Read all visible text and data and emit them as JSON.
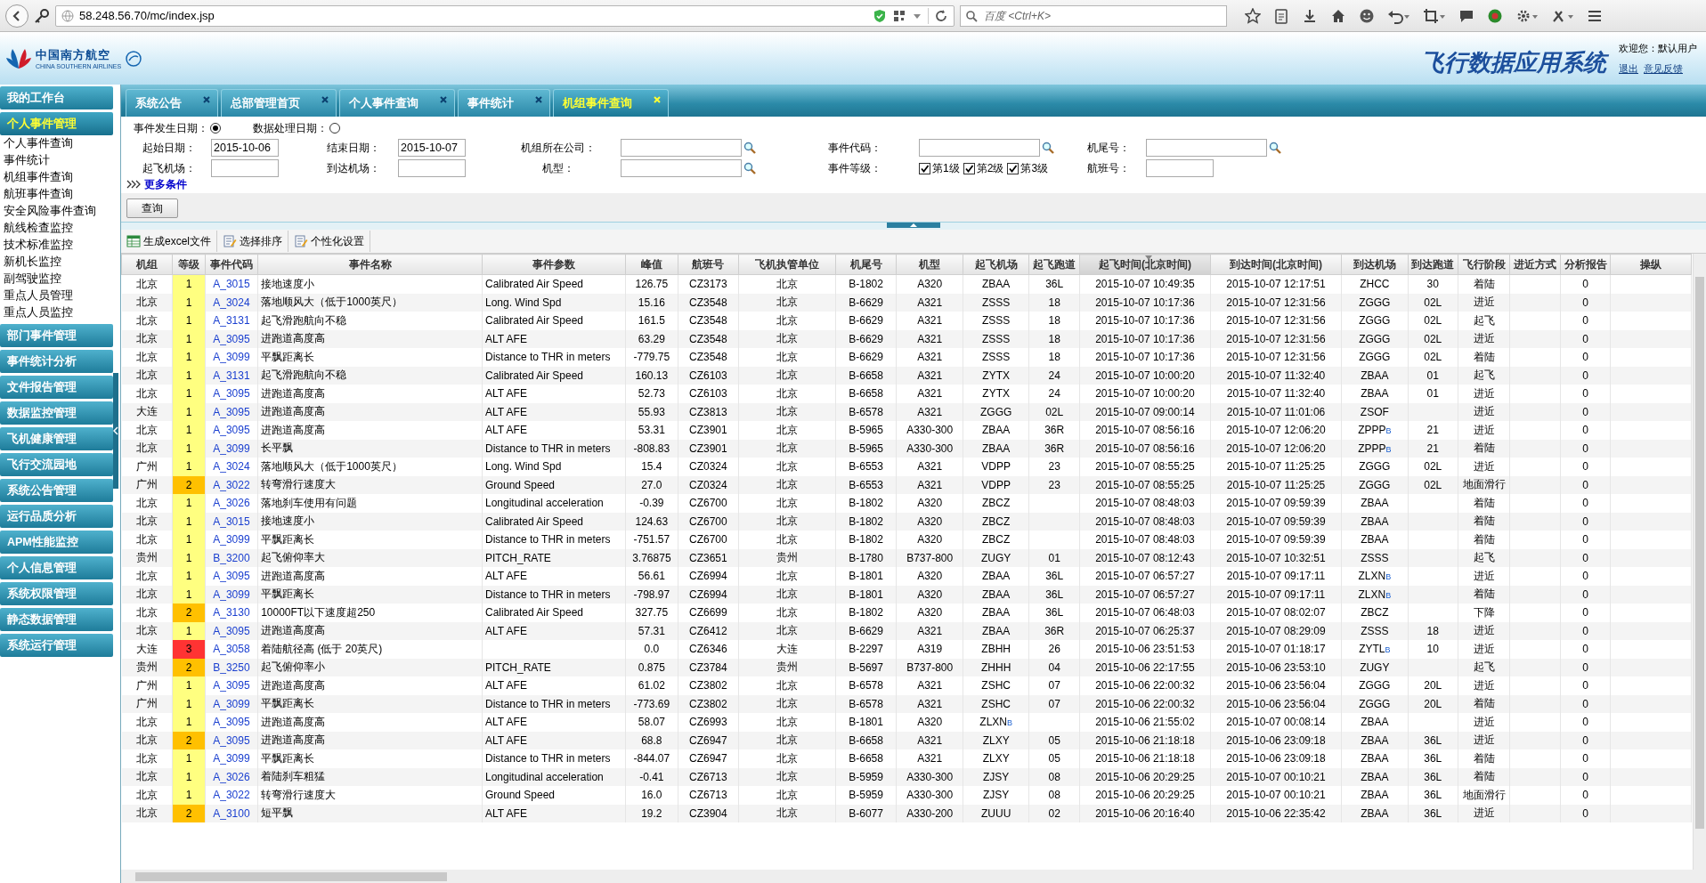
{
  "browser": {
    "url": "58.248.56.70/mc/index.jsp",
    "search": {
      "placeholder": "百度 <Ctrl+K>"
    }
  },
  "header": {
    "logo_cn": "中国南方航空",
    "logo_en": "CHINA SOUTHERN AIRLINES",
    "title": "飞行数据应用系统",
    "welcome": "欢迎您：默认用户",
    "links": [
      "退出",
      "意见反馈"
    ]
  },
  "sidebar": {
    "items": [
      {
        "label": "我的工作台",
        "selected": false
      },
      {
        "label": "个人事件管理",
        "selected": true,
        "children": [
          {
            "label": "个人事件查询"
          },
          {
            "label": "事件统计"
          },
          {
            "label": "机组事件查询"
          },
          {
            "label": "航班事件查询"
          },
          {
            "label": "安全风险事件查询"
          },
          {
            "label": "航线检查监控"
          },
          {
            "label": "技术标准监控"
          },
          {
            "label": "新机长监控"
          },
          {
            "label": "副驾驶监控"
          },
          {
            "label": "重点人员管理"
          },
          {
            "label": "重点人员监控"
          }
        ]
      },
      {
        "label": "部门事件管理",
        "selected": false
      },
      {
        "label": "事件统计分析",
        "selected": false
      },
      {
        "label": "文件报告管理",
        "selected": false
      },
      {
        "label": "数据监控管理",
        "selected": false
      },
      {
        "label": "飞机健康管理",
        "selected": false
      },
      {
        "label": "飞行交流园地",
        "selected": false
      },
      {
        "label": "系统公告管理",
        "selected": false
      },
      {
        "label": "运行品质分析",
        "selected": false
      },
      {
        "label": "APM性能监控",
        "selected": false
      },
      {
        "label": "个人信息管理",
        "selected": false
      },
      {
        "label": "系统权限管理",
        "selected": false
      },
      {
        "label": "静态数据管理",
        "selected": false
      },
      {
        "label": "系统运行管理",
        "selected": false
      }
    ]
  },
  "tabs": [
    {
      "label": "系统公告",
      "selected": false
    },
    {
      "label": "总部管理首页",
      "selected": false
    },
    {
      "label": "个人事件查询",
      "selected": false
    },
    {
      "label": "事件统计",
      "selected": false
    },
    {
      "label": "机组事件查询",
      "selected": true
    }
  ],
  "filter": {
    "date_modes": [
      {
        "label": "事件发生日期：",
        "selected": true
      },
      {
        "label": "数据处理日期：",
        "selected": false
      }
    ],
    "fields": [
      {
        "kind": "text",
        "label": "起始日期：",
        "value": "2015-10-06"
      },
      {
        "kind": "text",
        "label": "结束日期：",
        "value": "2015-10-07"
      },
      {
        "kind": "lookup",
        "label": "机组所在公司："
      },
      {
        "kind": "lookup",
        "label": "事件代码："
      },
      {
        "kind": "lookup",
        "label": "机尾号："
      },
      {
        "kind": "text",
        "label": "起飞机场："
      },
      {
        "kind": "text",
        "label": "到达机场："
      },
      {
        "kind": "lookup",
        "label": "机型："
      },
      {
        "kind": "checks",
        "label": "事件等级：",
        "options": [
          {
            "label": "第1级",
            "checked": true
          },
          {
            "label": "第2级",
            "checked": true
          },
          {
            "label": "第3级",
            "checked": true
          }
        ]
      },
      {
        "kind": "text",
        "label": "航班号："
      }
    ],
    "more": "更多条件",
    "query": "查询"
  },
  "toolbar": [
    "生成excel文件",
    "选择排序",
    "个性化设置"
  ],
  "table": {
    "columns": [
      {
        "label": "机组",
        "sorted": false
      },
      {
        "label": "等级",
        "sorted": false
      },
      {
        "label": "事件代码",
        "sorted": false
      },
      {
        "label": "事件名称",
        "sorted": false
      },
      {
        "label": "事件参数",
        "sorted": false
      },
      {
        "label": "峰值",
        "sorted": false
      },
      {
        "label": "航班号",
        "sorted": false
      },
      {
        "label": "飞机执管单位",
        "sorted": false
      },
      {
        "label": "机尾号",
        "sorted": false
      },
      {
        "label": "机型",
        "sorted": false
      },
      {
        "label": "起飞机场",
        "sorted": false
      },
      {
        "label": "起飞跑道",
        "sorted": false
      },
      {
        "label": "起飞时间(北京时间)",
        "sorted": true
      },
      {
        "label": "到达时间(北京时间)",
        "sorted": false
      },
      {
        "label": "到达机场",
        "sorted": false
      },
      {
        "label": "到达跑道",
        "sorted": false
      },
      {
        "label": "飞行阶段",
        "sorted": false
      },
      {
        "label": "进近方式",
        "sorted": false
      },
      {
        "label": "分析报告",
        "sorted": false
      },
      {
        "label": "操纵",
        "sorted": false
      }
    ],
    "rows": [
      {
        "unit": "北京",
        "grade": "1",
        "color": "#ffff80",
        "code": "A_3015",
        "name": "接地速度小",
        "param": "Calibrated Air Speed",
        "peak": "126.75",
        "flight": "CZ3173",
        "owner": "北京",
        "tail": "B-1802",
        "type": "A320",
        "dep": "ZBAA",
        "dep_rwy": "36L",
        "dep_time": "2015-10-07 10:49:35",
        "arr_time": "2015-10-07 12:17:51",
        "arr": "ZHCC",
        "arr_rwy": "30",
        "phase": "着陆",
        "report": "0"
      },
      {
        "unit": "北京",
        "grade": "1",
        "color": "#ffff80",
        "code": "A_3024",
        "name": "落地顺风大（低于1000英尺）",
        "param": "Long. Wind Spd",
        "peak": "15.16",
        "flight": "CZ3548",
        "owner": "北京",
        "tail": "B-6629",
        "type": "A321",
        "dep": "ZSSS",
        "dep_rwy": "18",
        "dep_time": "2015-10-07 10:17:36",
        "arr_time": "2015-10-07 12:31:56",
        "arr": "ZGGG",
        "arr_rwy": "02L",
        "phase": "进近",
        "report": "0"
      },
      {
        "unit": "北京",
        "grade": "1",
        "color": "#ffff80",
        "code": "A_3131",
        "name": "起飞滑跑航向不稳",
        "param": "Calibrated Air Speed",
        "peak": "161.5",
        "flight": "CZ3548",
        "owner": "北京",
        "tail": "B-6629",
        "type": "A321",
        "dep": "ZSSS",
        "dep_rwy": "18",
        "dep_time": "2015-10-07 10:17:36",
        "arr_time": "2015-10-07 12:31:56",
        "arr": "ZGGG",
        "arr_rwy": "02L",
        "phase": "起飞",
        "report": "0"
      },
      {
        "unit": "北京",
        "grade": "1",
        "color": "#ffff80",
        "code": "A_3095",
        "name": "进跑道高度高",
        "param": "ALT AFE",
        "peak": "63.29",
        "flight": "CZ3548",
        "owner": "北京",
        "tail": "B-6629",
        "type": "A321",
        "dep": "ZSSS",
        "dep_rwy": "18",
        "dep_time": "2015-10-07 10:17:36",
        "arr_time": "2015-10-07 12:31:56",
        "arr": "ZGGG",
        "arr_rwy": "02L",
        "phase": "进近",
        "report": "0"
      },
      {
        "unit": "北京",
        "grade": "1",
        "color": "#ffff80",
        "code": "A_3099",
        "name": "平飘距离长",
        "param": "Distance to THR in meters",
        "peak": "-779.75",
        "flight": "CZ3548",
        "owner": "北京",
        "tail": "B-6629",
        "type": "A321",
        "dep": "ZSSS",
        "dep_rwy": "18",
        "dep_time": "2015-10-07 10:17:36",
        "arr_time": "2015-10-07 12:31:56",
        "arr": "ZGGG",
        "arr_rwy": "02L",
        "phase": "着陆",
        "report": "0"
      },
      {
        "unit": "北京",
        "grade": "1",
        "color": "#ffff80",
        "code": "A_3131",
        "name": "起飞滑跑航向不稳",
        "param": "Calibrated Air Speed",
        "peak": "160.13",
        "flight": "CZ6103",
        "owner": "北京",
        "tail": "B-6658",
        "type": "A321",
        "dep": "ZYTX",
        "dep_rwy": "24",
        "dep_time": "2015-10-07 10:00:20",
        "arr_time": "2015-10-07 11:32:40",
        "arr": "ZBAA",
        "arr_rwy": "01",
        "phase": "起飞",
        "report": "0"
      },
      {
        "unit": "北京",
        "grade": "1",
        "color": "#ffff80",
        "code": "A_3095",
        "name": "进跑道高度高",
        "param": "ALT AFE",
        "peak": "52.73",
        "flight": "CZ6103",
        "owner": "北京",
        "tail": "B-6658",
        "type": "A321",
        "dep": "ZYTX",
        "dep_rwy": "24",
        "dep_time": "2015-10-07 10:00:20",
        "arr_time": "2015-10-07 11:32:40",
        "arr": "ZBAA",
        "arr_rwy": "01",
        "phase": "进近",
        "report": "0"
      },
      {
        "unit": "大连",
        "grade": "1",
        "color": "#ffff80",
        "code": "A_3095",
        "name": "进跑道高度高",
        "param": "ALT AFE",
        "peak": "55.93",
        "flight": "CZ3813",
        "owner": "北京",
        "tail": "B-6578",
        "type": "A321",
        "dep": "ZGGG",
        "dep_rwy": "02L",
        "dep_time": "2015-10-07 09:00:14",
        "arr_time": "2015-10-07 11:01:06",
        "arr": "ZSOF",
        "phase": "进近",
        "report": "0"
      },
      {
        "unit": "北京",
        "grade": "1",
        "color": "#ffff80",
        "code": "A_3095",
        "name": "进跑道高度高",
        "param": "ALT AFE",
        "peak": "53.31",
        "flight": "CZ3901",
        "owner": "北京",
        "tail": "B-5965",
        "type": "A330-300",
        "dep": "ZBAA",
        "dep_rwy": "36R",
        "dep_time": "2015-10-07 08:56:16",
        "arr_time": "2015-10-07 12:06:20",
        "arr": "ZPPP",
        "arr_badge": "B",
        "arr_rwy": "21",
        "phase": "进近",
        "report": "0"
      },
      {
        "unit": "北京",
        "grade": "1",
        "color": "#ffff80",
        "code": "A_3099",
        "name": "长平飘",
        "param": "Distance to THR in meters",
        "peak": "-808.83",
        "flight": "CZ3901",
        "owner": "北京",
        "tail": "B-5965",
        "type": "A330-300",
        "dep": "ZBAA",
        "dep_rwy": "36R",
        "dep_time": "2015-10-07 08:56:16",
        "arr_time": "2015-10-07 12:06:20",
        "arr": "ZPPP",
        "arr_badge": "B",
        "arr_rwy": "21",
        "phase": "着陆",
        "report": "0"
      },
      {
        "unit": "广州",
        "grade": "1",
        "color": "#ffff80",
        "code": "A_3024",
        "name": "落地顺风大（低于1000英尺）",
        "param": "Long. Wind Spd",
        "peak": "15.4",
        "flight": "CZ0324",
        "owner": "北京",
        "tail": "B-6553",
        "type": "A321",
        "dep": "VDPP",
        "dep_rwy": "23",
        "dep_time": "2015-10-07 08:55:25",
        "arr_time": "2015-10-07 11:25:25",
        "arr": "ZGGG",
        "arr_rwy": "02L",
        "phase": "进近",
        "report": "0"
      },
      {
        "unit": "广州",
        "grade": "2",
        "color": "#ffc000",
        "code": "A_3022",
        "name": "转弯滑行速度大",
        "param": "Ground Speed",
        "peak": "27.0",
        "flight": "CZ0324",
        "owner": "北京",
        "tail": "B-6553",
        "type": "A321",
        "dep": "VDPP",
        "dep_rwy": "23",
        "dep_time": "2015-10-07 08:55:25",
        "arr_time": "2015-10-07 11:25:25",
        "arr": "ZGGG",
        "arr_rwy": "02L",
        "phase": "地面滑行",
        "report": "0"
      },
      {
        "unit": "北京",
        "grade": "1",
        "color": "#ffff80",
        "code": "A_3026",
        "name": "落地刹车使用有问题",
        "param": "Longitudinal acceleration",
        "peak": "-0.39",
        "flight": "CZ6700",
        "owner": "北京",
        "tail": "B-1802",
        "type": "A320",
        "dep": "ZBCZ",
        "dep_time": "2015-10-07 08:48:03",
        "arr_time": "2015-10-07 09:59:39",
        "arr": "ZBAA",
        "phase": "着陆",
        "report": "0"
      },
      {
        "unit": "北京",
        "grade": "1",
        "color": "#ffff80",
        "code": "A_3015",
        "name": "接地速度小",
        "param": "Calibrated Air Speed",
        "peak": "124.63",
        "flight": "CZ6700",
        "owner": "北京",
        "tail": "B-1802",
        "type": "A320",
        "dep": "ZBCZ",
        "dep_time": "2015-10-07 08:48:03",
        "arr_time": "2015-10-07 09:59:39",
        "arr": "ZBAA",
        "phase": "着陆",
        "report": "0"
      },
      {
        "unit": "北京",
        "grade": "1",
        "color": "#ffff80",
        "code": "A_3099",
        "name": "平飘距离长",
        "param": "Distance to THR in meters",
        "peak": "-751.57",
        "flight": "CZ6700",
        "owner": "北京",
        "tail": "B-1802",
        "type": "A320",
        "dep": "ZBCZ",
        "dep_time": "2015-10-07 08:48:03",
        "arr_time": "2015-10-07 09:59:39",
        "arr": "ZBAA",
        "phase": "着陆",
        "report": "0"
      },
      {
        "unit": "贵州",
        "grade": "1",
        "color": "#ffff80",
        "code": "B_3200",
        "name": "起飞俯仰率大",
        "param": "PITCH_RATE",
        "peak": "3.76875",
        "flight": "CZ3651",
        "owner": "贵州",
        "tail": "B-1780",
        "type": "B737-800",
        "dep": "ZUGY",
        "dep_rwy": "01",
        "dep_time": "2015-10-07 08:12:43",
        "arr_time": "2015-10-07 10:32:51",
        "arr": "ZSSS",
        "phase": "起飞",
        "report": "0"
      },
      {
        "unit": "北京",
        "grade": "1",
        "color": "#ffff80",
        "code": "A_3095",
        "name": "进跑道高度高",
        "param": "ALT AFE",
        "peak": "56.61",
        "flight": "CZ6994",
        "owner": "北京",
        "tail": "B-1801",
        "type": "A320",
        "dep": "ZBAA",
        "dep_rwy": "36L",
        "dep_time": "2015-10-07 06:57:27",
        "arr_time": "2015-10-07 09:17:11",
        "arr": "ZLXN",
        "arr_badge": "B",
        "phase": "进近",
        "report": "0"
      },
      {
        "unit": "北京",
        "grade": "1",
        "color": "#ffff80",
        "code": "A_3099",
        "name": "平飘距离长",
        "param": "Distance to THR in meters",
        "peak": "-798.97",
        "flight": "CZ6994",
        "owner": "北京",
        "tail": "B-1801",
        "type": "A320",
        "dep": "ZBAA",
        "dep_rwy": "36L",
        "dep_time": "2015-10-07 06:57:27",
        "arr_time": "2015-10-07 09:17:11",
        "arr": "ZLXN",
        "arr_badge": "B",
        "phase": "着陆",
        "report": "0"
      },
      {
        "unit": "北京",
        "grade": "2",
        "color": "#ffc000",
        "code": "A_3130",
        "name": "10000FT以下速度超250",
        "param": "Calibrated Air Speed",
        "peak": "327.75",
        "flight": "CZ6699",
        "owner": "北京",
        "tail": "B-1802",
        "type": "A320",
        "dep": "ZBAA",
        "dep_rwy": "36L",
        "dep_time": "2015-10-07 06:48:03",
        "arr_time": "2015-10-07 08:02:07",
        "arr": "ZBCZ",
        "phase": "下降",
        "report": "0"
      },
      {
        "unit": "北京",
        "grade": "1",
        "color": "#ffff80",
        "code": "A_3095",
        "name": "进跑道高度高",
        "param": "ALT AFE",
        "peak": "57.31",
        "flight": "CZ6412",
        "owner": "北京",
        "tail": "B-6629",
        "type": "A321",
        "dep": "ZBAA",
        "dep_rwy": "36R",
        "dep_time": "2015-10-07 06:25:37",
        "arr_time": "2015-10-07 08:29:09",
        "arr": "ZSSS",
        "arr_rwy": "18",
        "phase": "进近",
        "report": "0"
      },
      {
        "unit": "大连",
        "grade": "3",
        "color": "#ff3333",
        "code": "A_3058",
        "name": "着陆航径高 (低于 20英尺)",
        "peak": "0.0",
        "flight": "CZ6346",
        "owner": "大连",
        "tail": "B-2297",
        "type": "A319",
        "dep": "ZBHH",
        "dep_rwy": "26",
        "dep_time": "2015-10-06 23:51:53",
        "arr_time": "2015-10-07 01:18:17",
        "arr": "ZYTL",
        "arr_badge": "B",
        "arr_rwy": "10",
        "phase": "进近",
        "report": "0"
      },
      {
        "unit": "贵州",
        "grade": "2",
        "color": "#ffc000",
        "code": "B_3250",
        "name": "起飞俯仰率小",
        "param": "PITCH_RATE",
        "peak": "0.875",
        "flight": "CZ3784",
        "owner": "贵州",
        "tail": "B-5697",
        "type": "B737-800",
        "dep": "ZHHH",
        "dep_rwy": "04",
        "dep_time": "2015-10-06 22:17:55",
        "arr_time": "2015-10-06 23:53:10",
        "arr": "ZUGY",
        "phase": "起飞",
        "report": "0"
      },
      {
        "unit": "广州",
        "grade": "1",
        "color": "#ffff80",
        "code": "A_3095",
        "name": "进跑道高度高",
        "param": "ALT AFE",
        "peak": "61.02",
        "flight": "CZ3802",
        "owner": "北京",
        "tail": "B-6578",
        "type": "A321",
        "dep": "ZSHC",
        "dep_rwy": "07",
        "dep_time": "2015-10-06 22:00:32",
        "arr_time": "2015-10-06 23:56:04",
        "arr": "ZGGG",
        "arr_rwy": "20L",
        "phase": "进近",
        "report": "0"
      },
      {
        "unit": "广州",
        "grade": "1",
        "color": "#ffff80",
        "code": "A_3099",
        "name": "平飘距离长",
        "param": "Distance to THR in meters",
        "peak": "-773.69",
        "flight": "CZ3802",
        "owner": "北京",
        "tail": "B-6578",
        "type": "A321",
        "dep": "ZSHC",
        "dep_rwy": "07",
        "dep_time": "2015-10-06 22:00:32",
        "arr_time": "2015-10-06 23:56:04",
        "arr": "ZGGG",
        "arr_rwy": "20L",
        "phase": "着陆",
        "report": "0"
      },
      {
        "unit": "北京",
        "grade": "1",
        "color": "#ffff80",
        "code": "A_3095",
        "name": "进跑道高度高",
        "param": "ALT AFE",
        "peak": "58.07",
        "flight": "CZ6993",
        "owner": "北京",
        "tail": "B-1801",
        "type": "A320",
        "dep": "ZLXN",
        "dep_badge": "B",
        "dep_time": "2015-10-06 21:55:02",
        "arr_time": "2015-10-07 00:08:14",
        "arr": "ZBAA",
        "phase": "进近",
        "report": "0"
      },
      {
        "unit": "北京",
        "grade": "2",
        "color": "#ffc000",
        "code": "A_3095",
        "name": "进跑道高度高",
        "param": "ALT AFE",
        "peak": "68.8",
        "flight": "CZ6947",
        "owner": "北京",
        "tail": "B-6658",
        "type": "A321",
        "dep": "ZLXY",
        "dep_rwy": "05",
        "dep_time": "2015-10-06 21:18:18",
        "arr_time": "2015-10-06 23:09:18",
        "arr": "ZBAA",
        "arr_rwy": "36L",
        "phase": "进近",
        "report": "0"
      },
      {
        "unit": "北京",
        "grade": "1",
        "color": "#ffff80",
        "code": "A_3099",
        "name": "平飘距离长",
        "param": "Distance to THR in meters",
        "peak": "-844.07",
        "flight": "CZ6947",
        "owner": "北京",
        "tail": "B-6658",
        "type": "A321",
        "dep": "ZLXY",
        "dep_rwy": "05",
        "dep_time": "2015-10-06 21:18:18",
        "arr_time": "2015-10-06 23:09:18",
        "arr": "ZBAA",
        "arr_rwy": "36L",
        "phase": "着陆",
        "report": "0"
      },
      {
        "unit": "北京",
        "grade": "1",
        "color": "#ffff80",
        "code": "A_3026",
        "name": "着陆刹车粗猛",
        "param": "Longitudinal acceleration",
        "peak": "-0.41",
        "flight": "CZ6713",
        "owner": "北京",
        "tail": "B-5959",
        "type": "A330-300",
        "dep": "ZJSY",
        "dep_rwy": "08",
        "dep_time": "2015-10-06 20:29:25",
        "arr_time": "2015-10-07 00:10:21",
        "arr": "ZBAA",
        "arr_rwy": "36L",
        "phase": "着陆",
        "report": "0"
      },
      {
        "unit": "北京",
        "grade": "1",
        "color": "#ffff80",
        "code": "A_3022",
        "name": "转弯滑行速度大",
        "param": "Ground Speed",
        "peak": "16.0",
        "flight": "CZ6713",
        "owner": "北京",
        "tail": "B-5959",
        "type": "A330-300",
        "dep": "ZJSY",
        "dep_rwy": "08",
        "dep_time": "2015-10-06 20:29:25",
        "arr_time": "2015-10-07 00:10:21",
        "arr": "ZBAA",
        "arr_rwy": "36L",
        "phase": "地面滑行",
        "report": "0"
      },
      {
        "unit": "北京",
        "grade": "2",
        "color": "#ffc000",
        "code": "A_3100",
        "name": "短平飘",
        "param": "ALT AFE",
        "peak": "19.2",
        "flight": "CZ3904",
        "owner": "北京",
        "tail": "B-6077",
        "type": "A330-200",
        "dep": "ZUUU",
        "dep_rwy": "02",
        "dep_time": "2015-10-06 20:16:40",
        "arr_time": "2015-10-06 22:35:42",
        "arr": "ZBAA",
        "arr_rwy": "36L",
        "phase": "进近",
        "report": "0"
      }
    ]
  }
}
